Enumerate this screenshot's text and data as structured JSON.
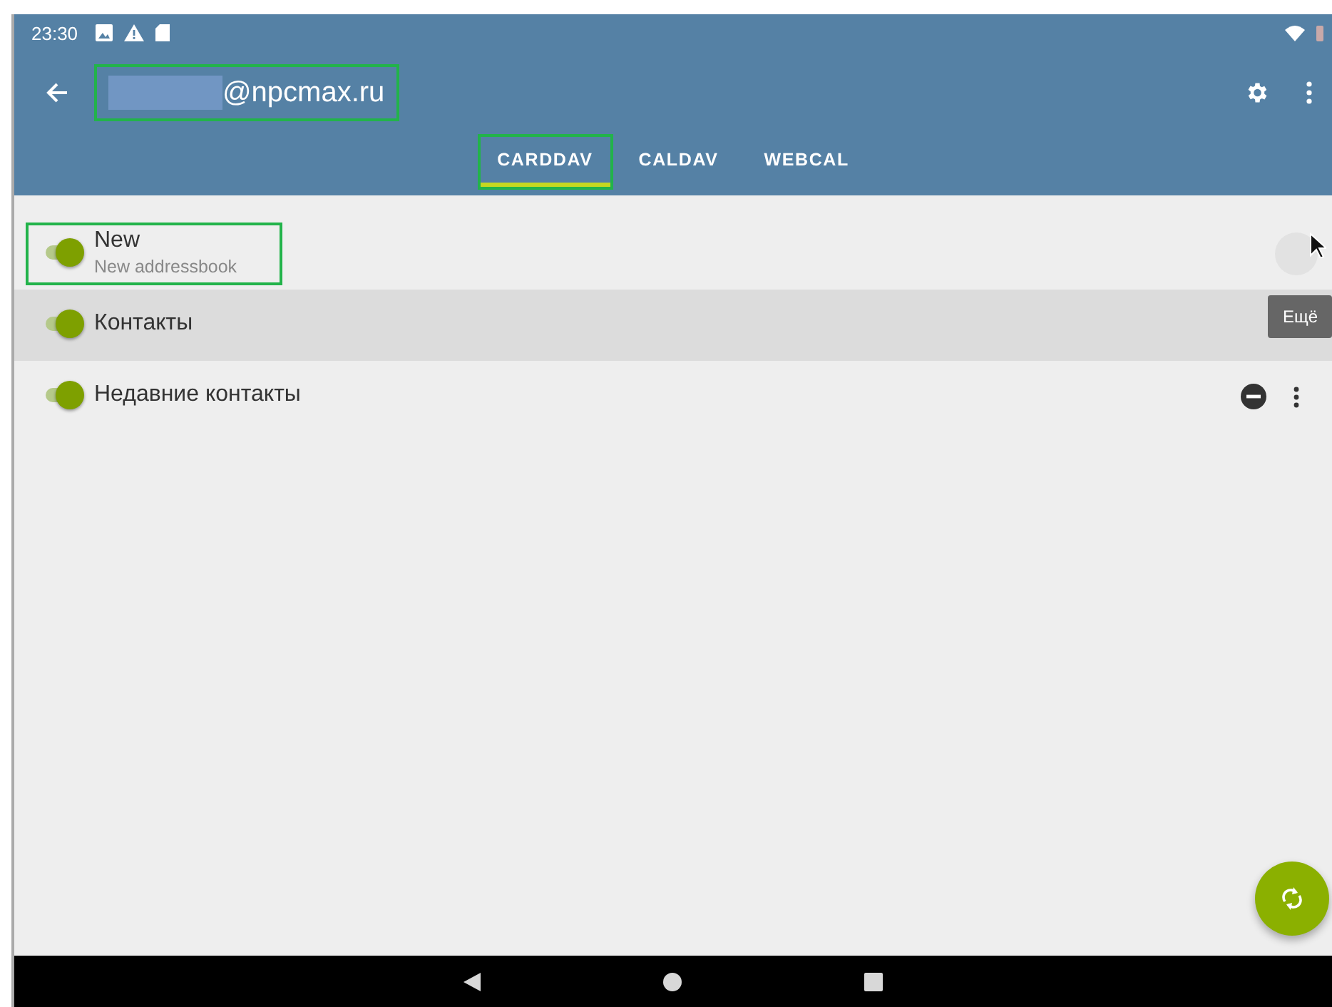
{
  "status_bar": {
    "time": "23:30"
  },
  "app_bar": {
    "title": "@npcmax.ru",
    "highlighted": true
  },
  "tabs": [
    {
      "label": "CARDDAV",
      "selected": true,
      "highlighted": true
    },
    {
      "label": "CALDAV",
      "selected": false,
      "highlighted": false
    },
    {
      "label": "WEBCAL",
      "selected": false,
      "highlighted": false
    }
  ],
  "collections": [
    {
      "name": "New",
      "description": "New addressbook",
      "on": true,
      "selected": false,
      "read_only": false,
      "hovered": true,
      "highlighted": true
    },
    {
      "name": "Контакты",
      "on": true,
      "selected": true,
      "read_only": false,
      "hovered": false,
      "highlighted": false
    },
    {
      "name": "Недавние контакты",
      "on": true,
      "selected": false,
      "read_only": true,
      "hovered": false,
      "highlighted": false
    }
  ],
  "tooltip": "Ещё"
}
